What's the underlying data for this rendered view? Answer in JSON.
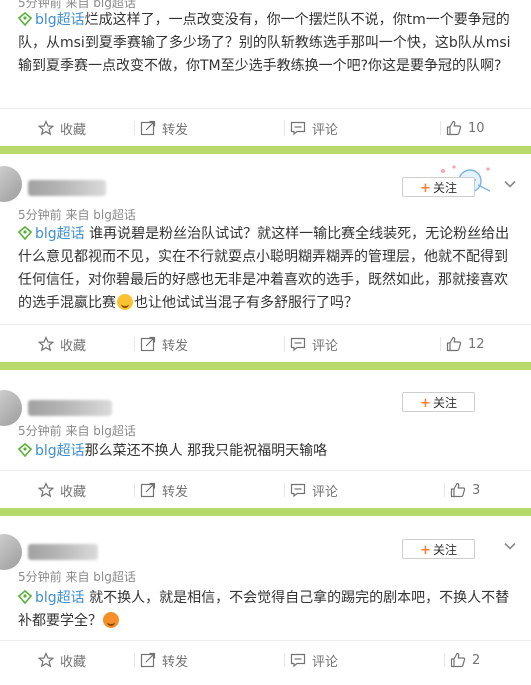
{
  "tag_color": "#3f8fd2",
  "separator_color": "#b7d96a",
  "follow_label": "关注",
  "actions": {
    "favorite": "收藏",
    "repost": "转发",
    "comment": "评论"
  },
  "posts": [
    {
      "meta": "5分钟前 来自 blg超话",
      "tag": "blg超话",
      "text": "烂成这样了，一点改变没有，你一个摆烂队不说，你tm一个要争冠的队，从msi到夏季赛输了多少场了？别的队斩教练选手那叫一个快，这b队从msi输到夏季赛一点改变不做，你TM至少选手教练换一个吧?你这是要争冠的队啊?",
      "likes": "10"
    },
    {
      "meta": "5分钟前 来自 blg超话",
      "tag": "blg超话",
      "text_before_emoji": "谁再说碧是粉丝治队试试？就这样一输比赛全线装死，无论粉丝给出什么意见都视而不见，实在不行就耍点小聪明糊弄糊弄的管理层，他就不配得到任何信任，对你碧最后的好感也无非是冲着喜欢的选手，既然如此，那就接喜欢的选手混嬴比赛",
      "emoji": "smile-emoji",
      "text_after_emoji": "也让他试试当混子有多舒服行了吗？",
      "likes": "12"
    },
    {
      "meta": "5分钟前 来自 blg超话",
      "tag": "blg超话",
      "text": "那么菜还不换人 那我只能祝福明天输咯",
      "likes": "3"
    },
    {
      "meta": "5分钟前 来自 blg超话",
      "tag": "blg超话",
      "text": "就不换人，就是相信，不会觉得自己拿的踢完的剧本吧，不换人不替补都要学全？",
      "emoji": "laughing-emoji",
      "likes": "2"
    }
  ]
}
